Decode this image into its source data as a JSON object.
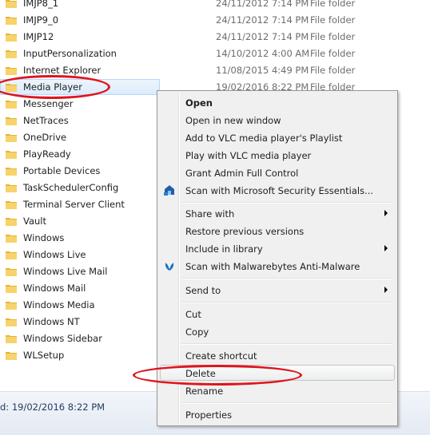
{
  "files": [
    {
      "name": "IMJP8_1",
      "date": "24/11/2012 7:14 PM",
      "type": "File folder"
    },
    {
      "name": "IMJP9_0",
      "date": "24/11/2012 7:14 PM",
      "type": "File folder"
    },
    {
      "name": "IMJP12",
      "date": "24/11/2012 7:14 PM",
      "type": "File folder"
    },
    {
      "name": "InputPersonalization",
      "date": "14/10/2012 4:00 AM",
      "type": "File folder"
    },
    {
      "name": "Internet Explorer",
      "date": "11/08/2015 4:49 PM",
      "type": "File folder"
    },
    {
      "name": "Media Player",
      "date": "19/02/2016 8:22 PM",
      "type": "File folder"
    },
    {
      "name": "Messenger"
    },
    {
      "name": "NetTraces"
    },
    {
      "name": "OneDrive"
    },
    {
      "name": "PlayReady"
    },
    {
      "name": "Portable Devices"
    },
    {
      "name": "TaskSchedulerConfig"
    },
    {
      "name": "Terminal Server Client"
    },
    {
      "name": "Vault"
    },
    {
      "name": "Windows"
    },
    {
      "name": "Windows Live"
    },
    {
      "name": "Windows Live Mail"
    },
    {
      "name": "Windows Mail"
    },
    {
      "name": "Windows Media"
    },
    {
      "name": "Windows NT"
    },
    {
      "name": "Windows Sidebar"
    },
    {
      "name": "WLSetup"
    }
  ],
  "status_bar": {
    "text": "d: 19/02/2016 8:22 PM"
  },
  "context_menu": {
    "open": "Open",
    "open_new_window": "Open in new window",
    "vlc_playlist": "Add to VLC media player's Playlist",
    "vlc_play": "Play with VLC media player",
    "grant_admin": "Grant Admin Full Control",
    "scan_mse": "Scan with Microsoft Security Essentials...",
    "share_with": "Share with",
    "restore_versions": "Restore previous versions",
    "include_library": "Include in library",
    "scan_malwarebytes": "Scan with Malwarebytes Anti-Malware",
    "send_to": "Send to",
    "cut": "Cut",
    "copy": "Copy",
    "create_shortcut": "Create shortcut",
    "delete": "Delete",
    "rename": "Rename",
    "properties": "Properties"
  },
  "colors": {
    "annotation": "#e0141b",
    "folder": "#f3c955",
    "menu_bg": "#f0f0f0"
  }
}
